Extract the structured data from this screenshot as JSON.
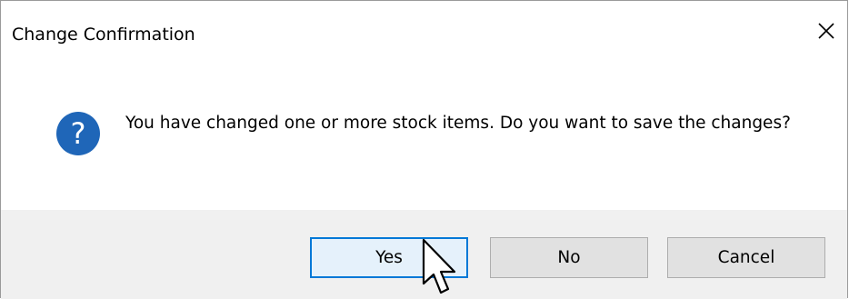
{
  "dialog": {
    "title": "Change Confirmation",
    "close_icon": "close-icon",
    "message": "You have changed one or more stock items. Do you want to save the changes?",
    "question_icon": "question-icon",
    "buttons": {
      "yes": "Yes",
      "no": "No",
      "cancel": "Cancel"
    },
    "focused_button": "yes"
  },
  "colors": {
    "accent": "#0078d7",
    "button_bg": "#e1e1e1",
    "button_area_bg": "#f0f0f0",
    "question_icon_bg": "#1f66b8"
  }
}
